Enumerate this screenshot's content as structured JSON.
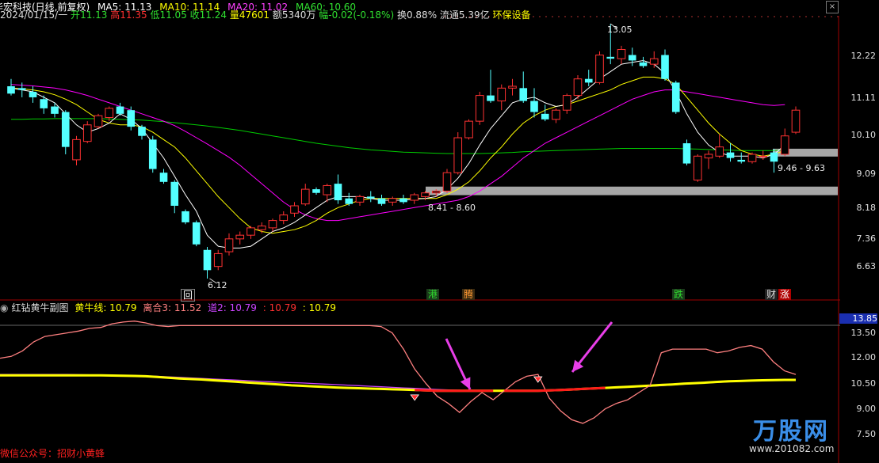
{
  "header": {
    "stock_name": "华宏科技(日线,前复权)",
    "date": "2024/01/15/一",
    "open_label": "开",
    "open": "11.13",
    "high_label": "高",
    "high": "11.35",
    "low_label": "低",
    "low": "11.05",
    "close_label": "收",
    "close": "11.24",
    "vol_label": "量",
    "vol": "47601",
    "amount": "额5340万",
    "change": "幅-0.02(-0.18%)",
    "turnover": "换0.88%",
    "float_cap": "流通5.39亿",
    "sector": "环保设备",
    "ma5": "MA5: 11.13",
    "ma10": "MA10: 11.14",
    "ma20": "MA20: 11.02",
    "ma60": "MA60: 10.60"
  },
  "sub_header": {
    "name": "红钻黄牛副图",
    "huangniu": "黄牛线: 10.79",
    "lihe": "离合3: 11.52",
    "dao": "道2: 10.79",
    "v1": ": 10.79",
    "v2": ": 10.79"
  },
  "main_axis": [
    "12.22",
    "11.11",
    "10.10",
    "9.09",
    "8.18",
    "7.36",
    "6.63"
  ],
  "sub_axis": [
    "13.85",
    "13.50",
    "12.00",
    "10.50",
    "9.00",
    "7.50"
  ],
  "annotations": {
    "high_mark": "13.05",
    "low_mark": "6.12",
    "band1": "9.46 - 9.63",
    "band2": "8.41 - 8.60"
  },
  "markers": {
    "hui": "回",
    "gang": "港",
    "teng": "腾",
    "die": "跌",
    "cai": "财",
    "zhang": "涨"
  },
  "footer": {
    "wechat": "微信公众号：招财小黄蜂",
    "brand": "万股网",
    "url": "www.201082.com"
  },
  "colors": {
    "up": "#ff3232",
    "down": "#54ffff",
    "ma5": "#ffffff",
    "ma10": "#ffff00",
    "ma20": "#ff00ff",
    "ma60": "#00cc00",
    "huangniu": "#ffff00",
    "lihe": "#ff8080",
    "dao": "#cc44ff",
    "arrow": "#e83ee8"
  },
  "chart_data": [
    {
      "type": "candlestick",
      "title": "华宏科技(日线,前复权)",
      "ylim": [
        6.1,
        13.2
      ],
      "ticks": [
        12.22,
        11.11,
        10.1,
        9.09,
        8.18,
        7.36,
        6.63
      ],
      "candles": [
        {
          "o": 11.35,
          "h": 11.55,
          "l": 11.1,
          "c": 11.15
        },
        {
          "o": 11.3,
          "h": 11.45,
          "l": 11.05,
          "c": 11.25
        },
        {
          "o": 11.2,
          "h": 11.35,
          "l": 10.9,
          "c": 11.05
        },
        {
          "o": 11.0,
          "h": 11.1,
          "l": 10.6,
          "c": 10.75
        },
        {
          "o": 10.8,
          "h": 10.9,
          "l": 10.5,
          "c": 10.6
        },
        {
          "o": 10.65,
          "h": 10.7,
          "l": 9.5,
          "c": 9.7
        },
        {
          "o": 9.35,
          "h": 10.0,
          "l": 9.2,
          "c": 9.9
        },
        {
          "o": 9.85,
          "h": 10.4,
          "l": 9.8,
          "c": 10.3
        },
        {
          "o": 10.25,
          "h": 10.6,
          "l": 10.2,
          "c": 10.55
        },
        {
          "o": 10.5,
          "h": 10.8,
          "l": 10.4,
          "c": 10.75
        },
        {
          "o": 10.8,
          "h": 10.9,
          "l": 10.55,
          "c": 10.6
        },
        {
          "o": 10.7,
          "h": 10.8,
          "l": 10.15,
          "c": 10.25
        },
        {
          "o": 10.25,
          "h": 10.3,
          "l": 9.9,
          "c": 10.0
        },
        {
          "o": 9.9,
          "h": 10.0,
          "l": 9.0,
          "c": 9.1
        },
        {
          "o": 9.0,
          "h": 9.1,
          "l": 8.7,
          "c": 8.75
        },
        {
          "o": 8.75,
          "h": 8.8,
          "l": 7.9,
          "c": 8.1
        },
        {
          "o": 7.95,
          "h": 8.0,
          "l": 7.6,
          "c": 7.65
        },
        {
          "o": 7.65,
          "h": 7.7,
          "l": 7.0,
          "c": 7.05
        },
        {
          "o": 6.9,
          "h": 6.98,
          "l": 6.12,
          "c": 6.35
        },
        {
          "o": 6.45,
          "h": 6.9,
          "l": 6.35,
          "c": 6.8
        },
        {
          "o": 6.85,
          "h": 7.35,
          "l": 6.75,
          "c": 7.2
        },
        {
          "o": 7.2,
          "h": 7.4,
          "l": 7.05,
          "c": 7.3
        },
        {
          "o": 7.3,
          "h": 7.55,
          "l": 7.2,
          "c": 7.5
        },
        {
          "o": 7.45,
          "h": 7.65,
          "l": 7.35,
          "c": 7.55
        },
        {
          "o": 7.5,
          "h": 7.75,
          "l": 7.4,
          "c": 7.7
        },
        {
          "o": 7.7,
          "h": 7.95,
          "l": 7.6,
          "c": 7.85
        },
        {
          "o": 7.9,
          "h": 8.2,
          "l": 7.8,
          "c": 8.1
        },
        {
          "o": 8.15,
          "h": 8.7,
          "l": 8.1,
          "c": 8.55
        },
        {
          "o": 8.55,
          "h": 8.6,
          "l": 8.4,
          "c": 8.45
        },
        {
          "o": 8.4,
          "h": 8.7,
          "l": 8.2,
          "c": 8.65
        },
        {
          "o": 8.7,
          "h": 8.95,
          "l": 8.15,
          "c": 8.25
        },
        {
          "o": 8.3,
          "h": 8.45,
          "l": 8.1,
          "c": 8.15
        },
        {
          "o": 8.2,
          "h": 8.4,
          "l": 8.1,
          "c": 8.35
        },
        {
          "o": 8.35,
          "h": 8.5,
          "l": 8.2,
          "c": 8.3
        },
        {
          "o": 8.3,
          "h": 8.4,
          "l": 8.1,
          "c": 8.15
        },
        {
          "o": 8.2,
          "h": 8.35,
          "l": 8.1,
          "c": 8.3
        },
        {
          "o": 8.3,
          "h": 8.4,
          "l": 8.15,
          "c": 8.2
        },
        {
          "o": 8.25,
          "h": 8.45,
          "l": 8.15,
          "c": 8.4
        },
        {
          "o": 8.35,
          "h": 8.5,
          "l": 8.25,
          "c": 8.45
        },
        {
          "o": 8.45,
          "h": 8.55,
          "l": 8.35,
          "c": 8.5
        },
        {
          "o": 8.5,
          "h": 9.1,
          "l": 8.45,
          "c": 9.0
        },
        {
          "o": 9.0,
          "h": 10.1,
          "l": 8.95,
          "c": 9.95
        },
        {
          "o": 9.95,
          "h": 10.45,
          "l": 9.9,
          "c": 10.4
        },
        {
          "o": 10.4,
          "h": 11.2,
          "l": 10.3,
          "c": 11.1
        },
        {
          "o": 11.1,
          "h": 11.8,
          "l": 10.9,
          "c": 10.95
        },
        {
          "o": 10.95,
          "h": 11.4,
          "l": 10.7,
          "c": 11.3
        },
        {
          "o": 11.3,
          "h": 11.55,
          "l": 11.1,
          "c": 11.35
        },
        {
          "o": 11.3,
          "h": 11.75,
          "l": 10.9,
          "c": 10.95
        },
        {
          "o": 10.95,
          "h": 11.3,
          "l": 10.5,
          "c": 10.65
        },
        {
          "o": 10.6,
          "h": 10.85,
          "l": 10.4,
          "c": 10.45
        },
        {
          "o": 10.45,
          "h": 10.75,
          "l": 10.35,
          "c": 10.7
        },
        {
          "o": 10.7,
          "h": 11.15,
          "l": 10.6,
          "c": 11.1
        },
        {
          "o": 11.1,
          "h": 11.65,
          "l": 11.0,
          "c": 11.55
        },
        {
          "o": 11.55,
          "h": 11.8,
          "l": 11.35,
          "c": 11.45
        },
        {
          "o": 11.45,
          "h": 12.3,
          "l": 11.4,
          "c": 12.2
        },
        {
          "o": 12.15,
          "h": 13.05,
          "l": 11.95,
          "c": 12.1
        },
        {
          "o": 12.1,
          "h": 12.45,
          "l": 11.95,
          "c": 12.35
        },
        {
          "o": 12.2,
          "h": 12.4,
          "l": 11.9,
          "c": 12.05
        },
        {
          "o": 12.0,
          "h": 12.15,
          "l": 11.85,
          "c": 11.9
        },
        {
          "o": 11.95,
          "h": 12.3,
          "l": 11.85,
          "c": 12.1
        },
        {
          "o": 12.2,
          "h": 12.35,
          "l": 11.5,
          "c": 11.55
        },
        {
          "o": 11.45,
          "h": 11.5,
          "l": 10.6,
          "c": 10.65
        },
        {
          "o": 9.8,
          "h": 9.9,
          "l": 9.2,
          "c": 9.25
        },
        {
          "o": 8.8,
          "h": 9.5,
          "l": 8.75,
          "c": 9.45
        },
        {
          "o": 9.4,
          "h": 9.6,
          "l": 9.1,
          "c": 9.5
        },
        {
          "o": 9.45,
          "h": 10.05,
          "l": 9.4,
          "c": 9.7
        },
        {
          "o": 9.55,
          "h": 9.8,
          "l": 9.3,
          "c": 9.4
        },
        {
          "o": 9.35,
          "h": 9.55,
          "l": 9.25,
          "c": 9.3
        },
        {
          "o": 9.3,
          "h": 9.55,
          "l": 9.25,
          "c": 9.5
        },
        {
          "o": 9.45,
          "h": 9.6,
          "l": 9.35,
          "c": 9.45
        },
        {
          "o": 9.55,
          "h": 9.65,
          "l": 9.0,
          "c": 9.3
        },
        {
          "o": 9.5,
          "h": 10.2,
          "l": 9.45,
          "c": 10.0
        },
        {
          "o": 10.1,
          "h": 10.8,
          "l": 10.05,
          "c": 10.7
        }
      ],
      "ma5": [
        11.3,
        11.25,
        11.2,
        11.05,
        10.9,
        10.6,
        10.3,
        10.1,
        10.2,
        10.35,
        10.6,
        10.45,
        10.2,
        9.8,
        9.4,
        8.9,
        8.4,
        7.95,
        7.3,
        7.0,
        6.95,
        6.95,
        7.0,
        7.2,
        7.4,
        7.5,
        7.65,
        7.85,
        8.05,
        8.25,
        8.35,
        8.35,
        8.35,
        8.3,
        8.25,
        8.25,
        8.25,
        8.28,
        8.3,
        8.35,
        8.55,
        8.85,
        9.25,
        9.75,
        10.2,
        10.55,
        10.9,
        11.0,
        11.05,
        10.9,
        10.8,
        10.85,
        11.05,
        11.3,
        11.55,
        11.75,
        11.95,
        12.0,
        12.05,
        11.95,
        11.7,
        11.2,
        10.6,
        10.1,
        9.75,
        9.55,
        9.45,
        9.45,
        9.45,
        9.4,
        9.5,
        9.75
      ],
      "ma10": [
        11.3,
        11.28,
        11.25,
        11.2,
        11.12,
        11.0,
        10.85,
        10.65,
        10.45,
        10.35,
        10.3,
        10.3,
        10.25,
        10.1,
        9.9,
        9.7,
        9.4,
        9.05,
        8.7,
        8.35,
        8.05,
        7.75,
        7.5,
        7.4,
        7.35,
        7.4,
        7.45,
        7.55,
        7.7,
        7.9,
        8.05,
        8.15,
        8.25,
        8.3,
        8.3,
        8.3,
        8.3,
        8.3,
        8.3,
        8.3,
        8.4,
        8.55,
        8.75,
        9.05,
        9.4,
        9.7,
        10.05,
        10.35,
        10.55,
        10.7,
        10.8,
        10.85,
        10.95,
        11.05,
        11.15,
        11.25,
        11.4,
        11.5,
        11.6,
        11.6,
        11.55,
        11.4,
        11.05,
        10.7,
        10.35,
        10.05,
        9.8,
        9.6,
        9.5,
        9.45,
        9.5,
        9.6
      ],
      "ma20": [
        11.4,
        11.38,
        11.36,
        11.33,
        11.3,
        11.25,
        11.18,
        11.1,
        11.0,
        10.9,
        10.8,
        10.7,
        10.6,
        10.5,
        10.4,
        10.28,
        10.12,
        9.95,
        9.78,
        9.6,
        9.42,
        9.2,
        8.95,
        8.7,
        8.45,
        8.2,
        8.0,
        7.85,
        7.75,
        7.7,
        7.7,
        7.75,
        7.8,
        7.85,
        7.9,
        7.95,
        8.0,
        8.05,
        8.1,
        8.15,
        8.2,
        8.25,
        8.35,
        8.5,
        8.7,
        8.9,
        9.15,
        9.4,
        9.6,
        9.8,
        9.95,
        10.1,
        10.25,
        10.4,
        10.55,
        10.7,
        10.85,
        11.0,
        11.1,
        11.2,
        11.25,
        11.25,
        11.2,
        11.15,
        11.1,
        11.05,
        11.0,
        10.95,
        10.9,
        10.85,
        10.83,
        10.85
      ],
      "ma60": [
        10.45,
        10.45,
        10.46,
        10.46,
        10.47,
        10.47,
        10.47,
        10.47,
        10.47,
        10.46,
        10.45,
        10.44,
        10.43,
        10.41,
        10.39,
        10.36,
        10.33,
        10.3,
        10.27,
        10.23,
        10.19,
        10.15,
        10.1,
        10.05,
        10.0,
        9.95,
        9.9,
        9.85,
        9.8,
        9.76,
        9.72,
        9.68,
        9.65,
        9.62,
        9.6,
        9.58,
        9.56,
        9.55,
        9.54,
        9.53,
        9.52,
        9.52,
        9.52,
        9.52,
        9.53,
        9.54,
        9.55,
        9.57,
        9.58,
        9.59,
        9.6,
        9.61,
        9.62,
        9.63,
        9.64,
        9.65,
        9.66,
        9.66,
        9.66,
        9.66,
        9.66,
        9.66,
        9.65,
        9.64,
        9.63,
        9.62,
        9.61,
        9.6,
        9.6,
        9.6,
        9.6,
        9.62
      ],
      "resistance_bands": [
        {
          "label": "9.46 - 9.63",
          "from": 9.46,
          "to": 9.63
        },
        {
          "label": "8.41 - 8.60",
          "from": 8.41,
          "to": 8.6
        }
      ]
    },
    {
      "type": "line",
      "title": "红钻黄牛副图",
      "ylim": [
        7.0,
        14.0
      ],
      "ticks": [
        13.5,
        12.0,
        10.5,
        9.0,
        7.5
      ],
      "series": [
        {
          "name": "离合3",
          "color": "#ff8080",
          "values": [
            11.7,
            11.8,
            12.1,
            12.6,
            12.9,
            13.0,
            13.1,
            13.2,
            13.35,
            13.4,
            13.6,
            13.7,
            13.75,
            13.65,
            13.5,
            13.45,
            13.5,
            13.5,
            13.5,
            13.5,
            13.5,
            13.5,
            13.5,
            13.5,
            13.5,
            13.5,
            13.5,
            13.5,
            13.5,
            13.5,
            13.5,
            13.5,
            13.5,
            13.5,
            13.45,
            13.1,
            12.2,
            11.1,
            10.3,
            9.6,
            9.2,
            8.7,
            9.3,
            9.8,
            9.4,
            9.9,
            10.4,
            10.7,
            10.8,
            9.5,
            8.8,
            8.3,
            8.1,
            8.4,
            8.9,
            9.2,
            9.4,
            9.8,
            10.2,
            12.0,
            12.2,
            12.2,
            12.2,
            12.2,
            12.0,
            12.1,
            12.3,
            12.4,
            12.2,
            11.5,
            11.0,
            10.8
          ]
        },
        {
          "name": "黄牛线",
          "color": "#ffff00",
          "values": [
            10.75,
            10.75,
            10.75,
            10.75,
            10.75,
            10.75,
            10.75,
            10.75,
            10.75,
            10.75,
            10.74,
            10.73,
            10.72,
            10.7,
            10.66,
            10.62,
            10.58,
            10.55,
            10.52,
            10.48,
            10.44,
            10.4,
            10.36,
            10.32,
            10.28,
            10.24,
            10.2,
            10.17,
            10.14,
            10.11,
            10.08,
            10.06,
            10.04,
            10.02,
            10.0,
            9.98,
            9.96,
            9.94,
            9.92,
            9.9,
            9.9,
            9.9,
            9.9,
            9.9,
            9.9,
            9.9,
            9.9,
            9.9,
            9.9,
            9.92,
            9.94,
            9.97,
            10.0,
            10.03,
            10.06,
            10.09,
            10.12,
            10.15,
            10.18,
            10.22,
            10.25,
            10.29,
            10.32,
            10.35,
            10.39,
            10.42,
            10.44,
            10.46,
            10.48,
            10.49,
            10.5,
            10.5
          ]
        },
        {
          "name": "道2",
          "color": "#cc44ff",
          "values": [
            10.8,
            10.8,
            10.8,
            10.8,
            10.8,
            10.8,
            10.8,
            10.79,
            10.78,
            10.76,
            10.75,
            10.74,
            10.73,
            10.72,
            10.7,
            10.67,
            10.64,
            10.61,
            10.58,
            10.55,
            10.52,
            10.49,
            10.46,
            10.43,
            10.4,
            10.37,
            10.35,
            10.33,
            10.3,
            10.27,
            10.24,
            10.21,
            10.18,
            10.15,
            10.12,
            10.09,
            10.06,
            10.03,
            10.0,
            9.97,
            9.95,
            9.93,
            9.91,
            9.9,
            9.9,
            9.9,
            9.9,
            9.9,
            9.9,
            9.9,
            9.92,
            9.94,
            9.97,
            10.0,
            10.03,
            10.06,
            10.09,
            10.12,
            10.15,
            10.18,
            10.22,
            10.26,
            10.3,
            10.33,
            10.36,
            10.39,
            10.42,
            10.44,
            10.46,
            10.48,
            10.49,
            10.5
          ]
        }
      ],
      "red_segment": [
        {
          "from": 37,
          "to": 44
        },
        {
          "from": 45,
          "to": 54
        }
      ],
      "diamonds": [
        {
          "index": 37,
          "value": 9.5
        },
        {
          "index": 48,
          "value": 10.5
        }
      ]
    }
  ]
}
